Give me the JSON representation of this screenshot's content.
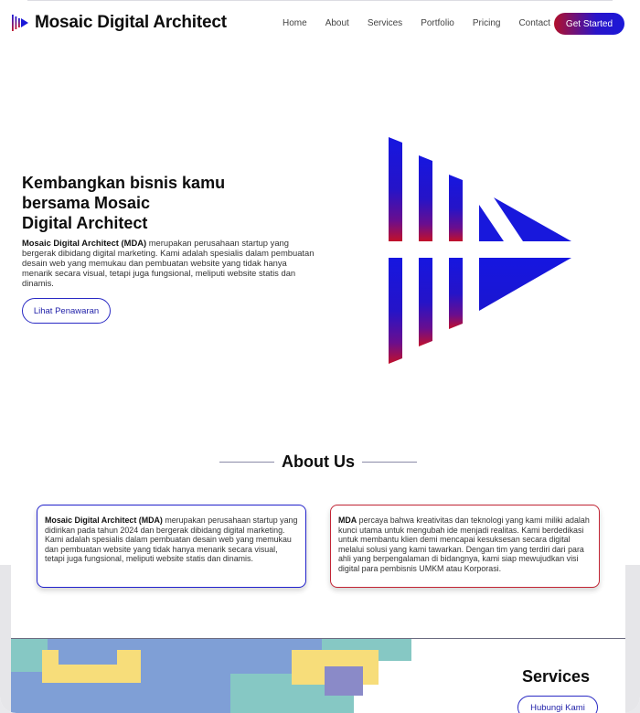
{
  "nav": {
    "brand": "Mosaic Digital Architect",
    "links": [
      "Home",
      "About",
      "Services",
      "Portfolio",
      "Pricing",
      "Contact"
    ],
    "cta": "Get Started"
  },
  "hero": {
    "title_line1": "Kembangkan bisnis kamu",
    "title_line2": "bersama Mosaic",
    "title_line3": "Digital Architect",
    "desc_bold": "Mosaic Digital Architect (MDA)",
    "desc_rest": " merupakan perusahaan startup yang bergerak dibidang digital marketing. Kami adalah spesialis dalam pembuatan desain web yang memukau dan pembuatan website yang tidak hanya menarik secara visual, tetapi juga fungsional, meliputi website statis dan dinamis.",
    "button": "Lihat Penawaran"
  },
  "about": {
    "title": "About Us",
    "card_left_bold": "Mosaic Digital Architect (MDA)",
    "card_left_rest": " merupakan perusahaan startup yang didirikan pada tahun 2024 dan bergerak dibidang digital marketing. Kami adalah spesialis dalam pembuatan desain web yang memukau dan pembuatan website yang tidak hanya menarik secara visual, tetapi juga fungsional, meliputi website statis dan dinamis.",
    "card_right_bold": "MDA",
    "card_right_rest": " percaya bahwa kreativitas dan teknologi yang kami miliki adalah kunci utama untuk mengubah ide menjadi realitas. Kami berdedikasi untuk membantu klien demi mencapai kesuksesan secara digital melalui solusi yang kami tawarkan. Dengan tim yang terdiri dari para ahli yang berpengalaman di bidangnya, kami siap mewujudkan visi digital para pembisnis UMKM atau Korporasi."
  },
  "services": {
    "title": "Services",
    "button": "Hubungi Kami"
  },
  "colors": {
    "blue": "#1a18d8",
    "red": "#c2102a",
    "art_blue": "#7f9fd6",
    "art_teal": "#86c8c4",
    "art_yellow": "#f7dd7a",
    "art_purple": "#8a8ac8"
  },
  "icons": {
    "brand": "mda-logo-icon",
    "hero": "mda-logo-large-icon"
  }
}
